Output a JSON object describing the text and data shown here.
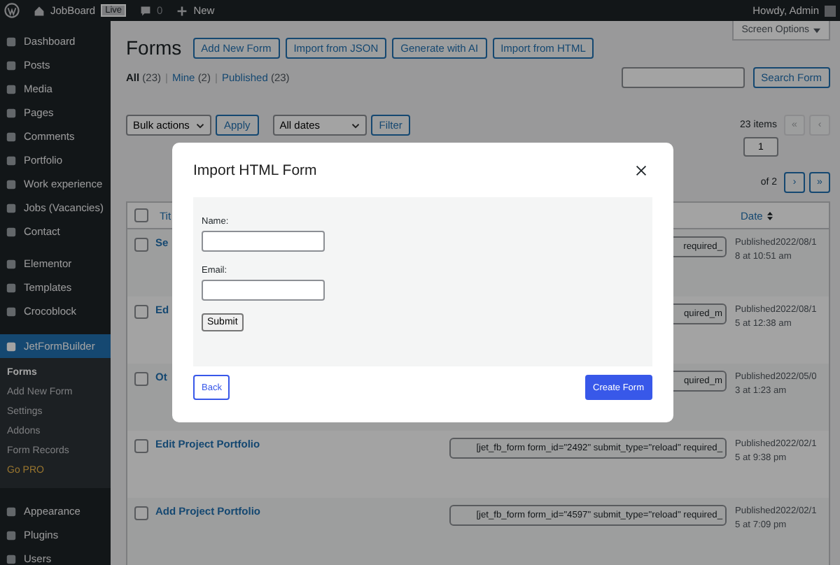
{
  "admin_bar": {
    "site": "JobBoard",
    "live_badge": "Live",
    "comments": "0",
    "new": "New",
    "greeting": "Howdy, Admin"
  },
  "sidebar": {
    "items": [
      {
        "label": "Dashboard",
        "selected": false
      },
      {
        "label": "Posts",
        "selected": false
      },
      {
        "label": "Media",
        "selected": false
      },
      {
        "label": "Pages",
        "selected": false
      },
      {
        "label": "Comments",
        "selected": false
      },
      {
        "label": "Portfolio",
        "selected": false
      },
      {
        "label": "Work experience",
        "selected": false
      },
      {
        "label": "Jobs (Vacancies)",
        "selected": false
      },
      {
        "label": "Contact",
        "selected": false
      },
      {
        "label": "Elementor",
        "selected": false
      },
      {
        "label": "Templates",
        "selected": false
      },
      {
        "label": "Crocoblock",
        "selected": false
      },
      {
        "label": "JetFormBuilder",
        "selected": true,
        "children": [
          {
            "label": "Forms",
            "selected": true,
            "kind": "link"
          },
          {
            "label": "Add New Form",
            "selected": false,
            "kind": "link"
          },
          {
            "label": "Settings",
            "selected": false,
            "kind": "link"
          },
          {
            "label": "Addons",
            "selected": false,
            "kind": "link"
          },
          {
            "label": "Form Records",
            "selected": false,
            "kind": "link"
          },
          {
            "label": "Go PRO",
            "selected": false,
            "kind": "upgrade"
          }
        ]
      },
      {
        "label": "Appearance",
        "selected": false
      },
      {
        "label": "Plugins",
        "selected": false
      },
      {
        "label": "Users",
        "selected": false
      }
    ]
  },
  "screen_options": "Screen Options",
  "page": {
    "title": "Forms",
    "header_buttons": [
      "Add New Form",
      "Import from JSON",
      "Generate with AI",
      "Import from HTML"
    ],
    "view_separator": "|",
    "views": [
      {
        "label": "All",
        "count": "(23)",
        "selected": true
      },
      {
        "label": "Mine",
        "count": "(2)",
        "selected": false
      },
      {
        "label": "Published",
        "count": "(23)",
        "selected": false
      }
    ],
    "search_button": "Search Form",
    "bulk_select": "Bulk actions",
    "apply": "Apply",
    "date_select": "All dates",
    "filter": "Filter",
    "pagination": {
      "items": "23 items",
      "first": "«",
      "prev": "‹",
      "page": "1",
      "of": "of 2",
      "next": "›",
      "last": "»"
    }
  },
  "table": {
    "select_all_checked": false,
    "columns": [
      "Tit",
      "Date"
    ],
    "rows": [
      {
        "checked": false,
        "title": "Se",
        "shortcode": "required_",
        "date_lines": [
          "Published2022/08/1",
          "8 at 10:51 am"
        ]
      },
      {
        "checked": false,
        "title": "Ed",
        "shortcode": "quired_m",
        "date_lines": [
          "Published2022/08/1",
          "5 at 12:38 am"
        ]
      },
      {
        "checked": false,
        "title": "Ot",
        "shortcode": "quired_m",
        "date_lines": [
          "Published2022/05/0",
          "3 at 1:23 am"
        ]
      },
      {
        "checked": false,
        "title": "Edit Project Portfolio",
        "shortcode": "[jet_fb_form form_id=\"2492\" submit_type=\"reload\" required_",
        "date_lines": [
          "Published2022/02/1",
          "5 at 9:38 pm"
        ]
      },
      {
        "checked": false,
        "title": "Add Project Portfolio",
        "shortcode": "[jet_fb_form form_id=\"4597\" submit_type=\"reload\" required_",
        "date_lines": [
          "Published2022/02/1",
          "5 at 7:09 pm"
        ]
      }
    ]
  },
  "modal": {
    "title": "Import HTML Form",
    "fields": [
      {
        "label": "Name:"
      },
      {
        "label": "Email:"
      }
    ],
    "submit": "Submit",
    "back": "Back",
    "create": "Create Form"
  }
}
